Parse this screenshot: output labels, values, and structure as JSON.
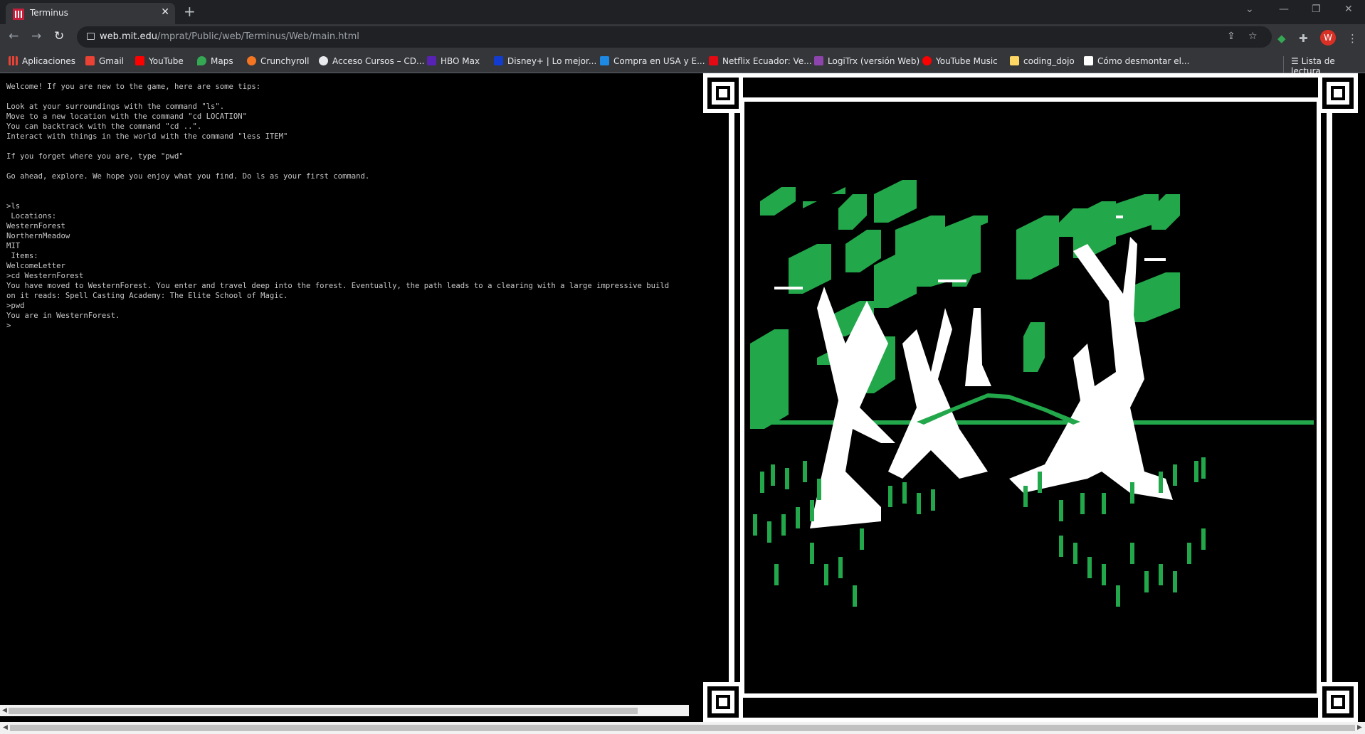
{
  "browser": {
    "tab": {
      "title": "Terminus"
    },
    "address_bar": {
      "host": "web.mit.edu",
      "path": "/mprat/Public/web/Terminus/Web/main.html"
    },
    "profile_initial": "W"
  },
  "bookmarks": [
    {
      "label": "Aplicaciones",
      "color": "#e8eaed"
    },
    {
      "label": "Gmail",
      "color": "#ea4335"
    },
    {
      "label": "YouTube",
      "color": "#ff0000"
    },
    {
      "label": "Maps",
      "color": "#34a853"
    },
    {
      "label": "Crunchyroll",
      "color": "#f47521"
    },
    {
      "label": "Acceso Cursos – CD...",
      "color": "#e8eaed"
    },
    {
      "label": "HBO Max",
      "color": "#5822b4"
    },
    {
      "label": "Disney+ | Lo mejor...",
      "color": "#113ccf"
    },
    {
      "label": "Compra en USA y E...",
      "color": "#1e88e5"
    },
    {
      "label": "Netflix Ecuador: Ve...",
      "color": "#e50914"
    },
    {
      "label": "LogiTrx (versión Web)",
      "color": "#8e44ad"
    },
    {
      "label": "YouTube Music",
      "color": "#ff0000"
    },
    {
      "label": "coding_dojo",
      "color": "#fdd663"
    },
    {
      "label": "Cómo desmontar el...",
      "color": "#ffffff"
    }
  ],
  "reading_list": "Lista de lectura",
  "terminal": {
    "lines": [
      "Welcome! If you are new to the game, here are some tips:",
      "",
      "Look at your surroundings with the command \"ls\".",
      "Move to a new location with the command \"cd LOCATION\"",
      "You can backtrack with the command \"cd ..\".",
      "Interact with things in the world with the command \"less ITEM\"",
      "",
      "If you forget where you are, type \"pwd\"",
      "",
      "Go ahead, explore. We hope you enjoy what you find. Do ls as your first command.",
      "",
      "",
      ">ls",
      " Locations:",
      "WesternForest",
      "NorthernMeadow",
      "MIT",
      " Items:",
      "WelcomeLetter",
      ">cd WesternForest",
      "You have moved to WesternForest. You enter and travel deep into the forest. Eventually, the path leads to a clearing with a large impressive build",
      "on it reads: Spell Casting Academy: The Elite School of Magic.",
      ">pwd",
      "You are in WesternForest.",
      ">"
    ]
  },
  "colors": {
    "leaf": "#22a84a",
    "trunk": "#ffffff",
    "background": "#000000"
  }
}
